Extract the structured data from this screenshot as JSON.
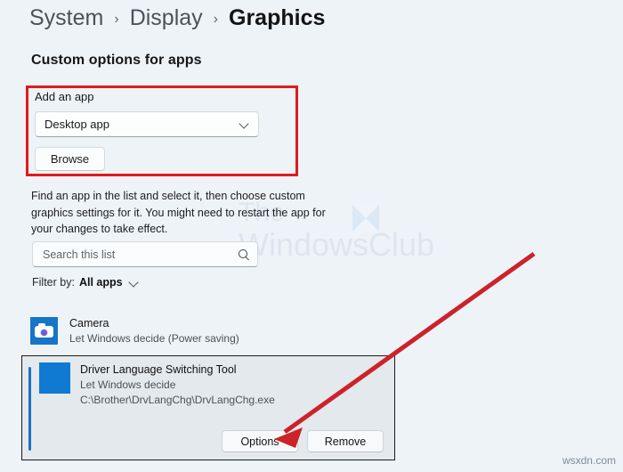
{
  "breadcrumb": {
    "items": [
      {
        "label": "System",
        "current": false
      },
      {
        "label": "Display",
        "current": false
      },
      {
        "label": "Graphics",
        "current": true
      }
    ],
    "separator": "›"
  },
  "section": {
    "title": "Custom options for apps",
    "description": "Find an app in the list and select it, then choose custom graphics settings for it. You might need to restart the app for your changes to take effect."
  },
  "add_app": {
    "label": "Add an app",
    "selected_type": "Desktop app",
    "browse_label": "Browse",
    "highlight_color": "#e01b1b"
  },
  "search": {
    "placeholder": "Search this list",
    "icon": "search-icon"
  },
  "filter": {
    "label": "Filter by:",
    "value": "All apps",
    "icon": "chevron-down-icon"
  },
  "app_list": [
    {
      "name": "Camera",
      "preference": "Let Windows decide (Power saving)",
      "icon": "camera-icon",
      "selected": false
    }
  ],
  "selected_app": {
    "name": "Driver Language Switching Tool",
    "preference": "Let Windows decide",
    "path": "C:\\Brother\\DrvLangChg\\DrvLangChg.exe",
    "icon": "generic-app-icon",
    "accent_color": "#1f6fc4",
    "options_label": "Options",
    "remove_label": "Remove"
  },
  "watermarks": {
    "club_line1": "The",
    "club_line2": "WindowsClub",
    "site": "wsxdn.com"
  },
  "annotation": {
    "arrow_color": "#cc2229",
    "points_to": "Options"
  }
}
